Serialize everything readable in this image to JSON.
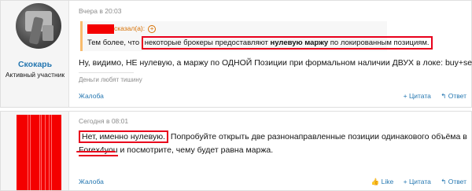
{
  "posts": [
    {
      "username": "Скокарь",
      "user_title": "Активный участник",
      "date": "Вчера в 20:03",
      "quote": {
        "author_suffix": "сказал(а):",
        "expand_icon": "plus-circle-icon",
        "text_before": "Тем более, что ",
        "text_boxed_pre": "некоторые брокеры предоставляют ",
        "text_boxed_bold": "нулевую маржу",
        "text_boxed_post": " по локированным позициям."
      },
      "body": "Ну, видимо, НЕ нулевую, а маржу по ОДНОЙ Позиции при формальном наличии ДВУХ в локе: buy+sell.",
      "signature": "Деньги любят тишину",
      "report": "Жалоба",
      "actions": [
        "+ Цитата",
        "↰ Ответ"
      ]
    },
    {
      "date": "Сегодня в 08:01",
      "body_boxed": "Нет, именно нулевую.",
      "body_line1_rest": " Попробуйте открыть две разнонаправленные позиции одинакового объёма в",
      "body_line2_link": "Forex4you",
      "body_line2_rest": " и посмотрите, чему будет равна маржа.",
      "report": "Жалоба",
      "actions": [
        "👍 Like",
        "+ Цитата",
        "↰ Ответ"
      ]
    }
  ],
  "colors": {
    "link": "#2577b1",
    "quote_border": "#f9bc6d",
    "redaction": "#f40000",
    "highlight_box": "#e8001c"
  }
}
